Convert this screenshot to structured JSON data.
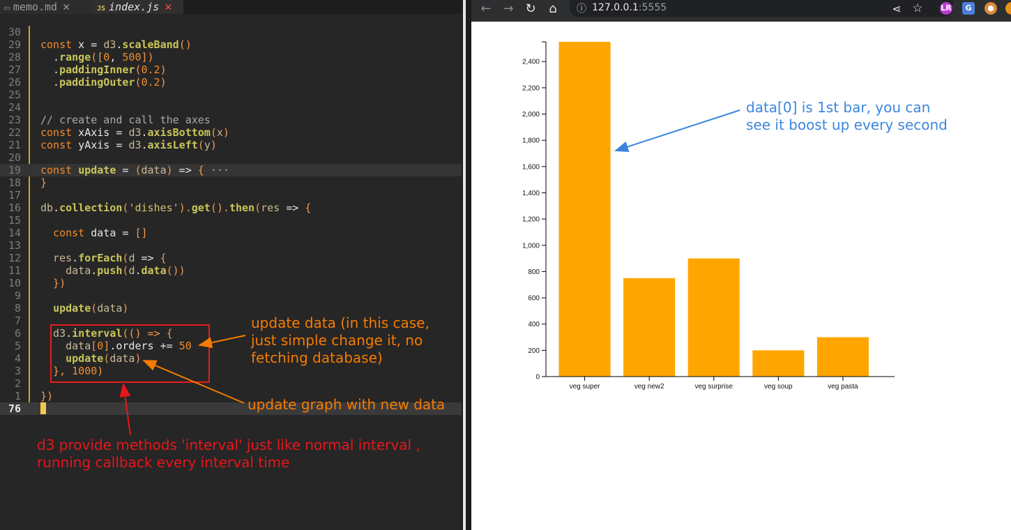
{
  "editor": {
    "tabs": [
      {
        "label": "memo.md",
        "icon": "file-icon",
        "close": "✕",
        "active": false
      },
      {
        "label": "index.js",
        "icon": "js-file-icon",
        "icon_text": "JS",
        "close": "✕",
        "active": true
      }
    ],
    "lines": [
      {
        "num": "30",
        "code": [
          {
            "t": "",
            "c": "p"
          }
        ]
      },
      {
        "num": "29",
        "code": [
          {
            "t": "const",
            "c": "k"
          },
          {
            "t": " x = ",
            "c": "p"
          },
          {
            "t": "d3",
            "c": "v"
          },
          {
            "t": ".",
            "c": "p"
          },
          {
            "t": "scaleBand",
            "c": "f"
          },
          {
            "t": "()",
            "c": "pa"
          }
        ]
      },
      {
        "num": "28",
        "code": [
          {
            "t": "  .",
            "c": "p"
          },
          {
            "t": "range",
            "c": "f"
          },
          {
            "t": "([",
            "c": "pa"
          },
          {
            "t": "0",
            "c": "n"
          },
          {
            "t": ", ",
            "c": "p"
          },
          {
            "t": "500",
            "c": "n"
          },
          {
            "t": "])",
            "c": "pa"
          }
        ]
      },
      {
        "num": "27",
        "code": [
          {
            "t": "  .",
            "c": "p"
          },
          {
            "t": "paddingInner",
            "c": "f"
          },
          {
            "t": "(",
            "c": "pa"
          },
          {
            "t": "0.2",
            "c": "n"
          },
          {
            "t": ")",
            "c": "pa"
          }
        ]
      },
      {
        "num": "26",
        "code": [
          {
            "t": "  .",
            "c": "p"
          },
          {
            "t": "paddingOuter",
            "c": "f"
          },
          {
            "t": "(",
            "c": "pa"
          },
          {
            "t": "0.2",
            "c": "n"
          },
          {
            "t": ")",
            "c": "pa"
          }
        ]
      },
      {
        "num": "25",
        "code": [
          {
            "t": "",
            "c": "p"
          }
        ]
      },
      {
        "num": "24",
        "code": [
          {
            "t": "",
            "c": "p"
          }
        ]
      },
      {
        "num": "23",
        "code": [
          {
            "t": "// create and call the axes",
            "c": "c"
          }
        ]
      },
      {
        "num": "22",
        "code": [
          {
            "t": "const",
            "c": "k"
          },
          {
            "t": " xAxis = ",
            "c": "p"
          },
          {
            "t": "d3",
            "c": "v"
          },
          {
            "t": ".",
            "c": "p"
          },
          {
            "t": "axisBottom",
            "c": "f"
          },
          {
            "t": "(",
            "c": "pa"
          },
          {
            "t": "x",
            "c": "v"
          },
          {
            "t": ")",
            "c": "pa"
          }
        ]
      },
      {
        "num": "21",
        "code": [
          {
            "t": "const",
            "c": "k"
          },
          {
            "t": " yAxis = ",
            "c": "p"
          },
          {
            "t": "d3",
            "c": "v"
          },
          {
            "t": ".",
            "c": "p"
          },
          {
            "t": "axisLeft",
            "c": "f"
          },
          {
            "t": "(",
            "c": "pa"
          },
          {
            "t": "y",
            "c": "v"
          },
          {
            "t": ")",
            "c": "pa"
          }
        ]
      },
      {
        "num": "20",
        "code": [
          {
            "t": "",
            "c": "p"
          }
        ]
      },
      {
        "num": "19",
        "hl": true,
        "code": [
          {
            "t": "const",
            "c": "k"
          },
          {
            "t": " ",
            "c": "p"
          },
          {
            "t": "update",
            "c": "f"
          },
          {
            "t": " = ",
            "c": "p"
          },
          {
            "t": "(",
            "c": "pa"
          },
          {
            "t": "data",
            "c": "v"
          },
          {
            "t": ")",
            "c": "pa"
          },
          {
            "t": " => ",
            "c": "p"
          },
          {
            "t": "{",
            "c": "pa"
          },
          {
            "t": " ···",
            "c": "c"
          }
        ]
      },
      {
        "num": "18",
        "code": [
          {
            "t": "}",
            "c": "pa"
          }
        ]
      },
      {
        "num": "17",
        "code": [
          {
            "t": "",
            "c": "p"
          }
        ]
      },
      {
        "num": "16",
        "code": [
          {
            "t": "db",
            "c": "v"
          },
          {
            "t": ".",
            "c": "p"
          },
          {
            "t": "collection",
            "c": "f"
          },
          {
            "t": "(",
            "c": "pa"
          },
          {
            "t": "'dishes'",
            "c": "s"
          },
          {
            "t": ").",
            "c": "pa"
          },
          {
            "t": "get",
            "c": "f"
          },
          {
            "t": "().",
            "c": "pa"
          },
          {
            "t": "then",
            "c": "f"
          },
          {
            "t": "(",
            "c": "pa"
          },
          {
            "t": "res",
            "c": "v"
          },
          {
            "t": " => ",
            "c": "p"
          },
          {
            "t": "{",
            "c": "pa"
          }
        ]
      },
      {
        "num": "15",
        "code": [
          {
            "t": "",
            "c": "p"
          }
        ]
      },
      {
        "num": "14",
        "code": [
          {
            "t": "  ",
            "c": "p"
          },
          {
            "t": "const",
            "c": "k"
          },
          {
            "t": " data = ",
            "c": "p"
          },
          {
            "t": "[]",
            "c": "pa"
          }
        ]
      },
      {
        "num": "13",
        "code": [
          {
            "t": "",
            "c": "p"
          }
        ]
      },
      {
        "num": "12",
        "code": [
          {
            "t": "  res",
            "c": "v"
          },
          {
            "t": ".",
            "c": "p"
          },
          {
            "t": "forEach",
            "c": "f"
          },
          {
            "t": "(",
            "c": "pa"
          },
          {
            "t": "d",
            "c": "v"
          },
          {
            "t": " => ",
            "c": "p"
          },
          {
            "t": "{",
            "c": "pa"
          }
        ]
      },
      {
        "num": "11",
        "code": [
          {
            "t": "    data",
            "c": "v"
          },
          {
            "t": ".",
            "c": "p"
          },
          {
            "t": "push",
            "c": "f"
          },
          {
            "t": "(",
            "c": "pa"
          },
          {
            "t": "d",
            "c": "v"
          },
          {
            "t": ".",
            "c": "p"
          },
          {
            "t": "data",
            "c": "f"
          },
          {
            "t": "())",
            "c": "pa"
          }
        ]
      },
      {
        "num": "10",
        "code": [
          {
            "t": "  })",
            "c": "pa"
          }
        ]
      },
      {
        "num": "9",
        "code": [
          {
            "t": "",
            "c": "p"
          }
        ]
      },
      {
        "num": "8",
        "code": [
          {
            "t": "  ",
            "c": "p"
          },
          {
            "t": "update",
            "c": "f"
          },
          {
            "t": "(",
            "c": "pa"
          },
          {
            "t": "data",
            "c": "v"
          },
          {
            "t": ")",
            "c": "pa"
          }
        ]
      },
      {
        "num": "7",
        "code": [
          {
            "t": "",
            "c": "p"
          }
        ]
      },
      {
        "num": "6",
        "code": [
          {
            "t": "  d3",
            "c": "v"
          },
          {
            "t": ".",
            "c": "p"
          },
          {
            "t": "interval",
            "c": "f"
          },
          {
            "t": "(() => {",
            "c": "pa"
          }
        ]
      },
      {
        "num": "5",
        "code": [
          {
            "t": "    data",
            "c": "v"
          },
          {
            "t": "[",
            "c": "pa"
          },
          {
            "t": "0",
            "c": "n"
          },
          {
            "t": "]",
            "c": "pa"
          },
          {
            "t": ".orders += ",
            "c": "p"
          },
          {
            "t": "50",
            "c": "n"
          }
        ]
      },
      {
        "num": "4",
        "code": [
          {
            "t": "    ",
            "c": "p"
          },
          {
            "t": "update",
            "c": "f"
          },
          {
            "t": "(",
            "c": "pa"
          },
          {
            "t": "data",
            "c": "v"
          },
          {
            "t": ")",
            "c": "pa"
          }
        ]
      },
      {
        "num": "3",
        "code": [
          {
            "t": "  }, ",
            "c": "pa"
          },
          {
            "t": "1000",
            "c": "n"
          },
          {
            "t": ")",
            "c": "pa"
          }
        ]
      },
      {
        "num": "2",
        "code": [
          {
            "t": "",
            "c": "p"
          }
        ]
      },
      {
        "num": "1",
        "code": [
          {
            "t": "})",
            "c": "pa"
          }
        ]
      },
      {
        "num": "76",
        "current": true,
        "code": [
          {
            "t": "",
            "c": "p"
          }
        ]
      }
    ],
    "annotations": {
      "update_data": "update data (in this case,\njust simple change it, no\nfetching database)",
      "update_graph": "update graph with new data",
      "interval": "d3 provide methods 'interval' just like normal interval ,\nrunning callback every interval time"
    },
    "colors": {
      "annotation_orange": "#f57c00",
      "annotation_red": "#e8161b"
    }
  },
  "browser": {
    "url_host": "127.0.0.1",
    "url_port": ":5555",
    "icons": [
      "back-icon",
      "forward-icon",
      "reload-icon",
      "home-icon",
      "site-info-icon",
      "share-icon",
      "bookmark-star-icon",
      "extension-lr-icon",
      "extension-translate-icon",
      "extension-cookie-icon",
      "extension-orange-icon"
    ],
    "annotation": "data[0] is 1st bar, you can\nsee it boost up every second",
    "colors": {
      "annotation_blue": "#3b86dd",
      "bar": "#ffa500"
    }
  },
  "chart_data": {
    "type": "bar",
    "categories": [
      "veg super",
      "veg new2",
      "veg surprise",
      "veg soup",
      "veg pasta"
    ],
    "values": [
      2550,
      750,
      900,
      200,
      300
    ],
    "ylim": [
      0,
      2550
    ],
    "yticks": [
      0,
      200,
      400,
      600,
      800,
      1000,
      1200,
      1400,
      1600,
      1800,
      2000,
      2200,
      2400
    ],
    "ytick_labels": [
      "0",
      "200",
      "400",
      "600",
      "800",
      "1,000",
      "1,200",
      "1,400",
      "1,600",
      "1,800",
      "2,000",
      "2,200",
      "2,400"
    ],
    "grid": false,
    "color": "#ffa500"
  }
}
